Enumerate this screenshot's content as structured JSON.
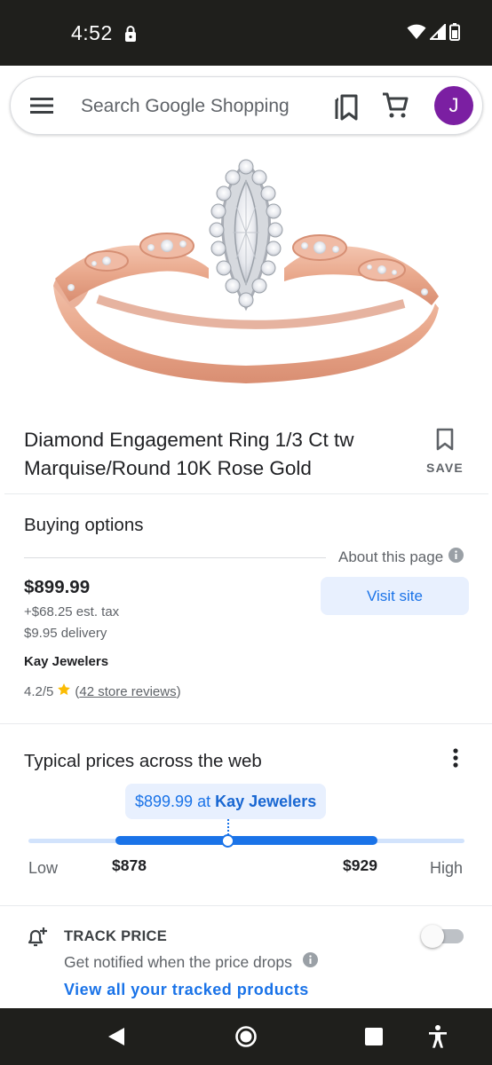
{
  "status_bar": {
    "time": "4:52"
  },
  "search": {
    "placeholder": "Search Google Shopping",
    "avatar_letter": "J"
  },
  "product": {
    "title": "Diamond Engagement Ring 1/3 Ct tw Marquise/Round 10K Rose Gold",
    "save_label": "SAVE"
  },
  "buying_options": {
    "heading": "Buying options",
    "about_label": "About this page",
    "price": "$899.99",
    "tax": "+$68.25 est. tax",
    "delivery": "$9.95 delivery",
    "store": "Kay Jewelers",
    "rating": "4.2/5",
    "reviews_link": "42 store reviews",
    "visit_label": "Visit site"
  },
  "typical_prices": {
    "heading": "Typical prices across the web",
    "current_price": "$899.99",
    "at_word": "at",
    "current_store": "Kay Jewelers",
    "low_label": "Low",
    "high_label": "High",
    "range_low": "$878",
    "range_high": "$929"
  },
  "track": {
    "title": "TRACK PRICE",
    "subtitle": "Get notified when the price drops",
    "link": "View all your tracked products",
    "enabled": false
  },
  "colors": {
    "accent": "#1a73e8",
    "avatar": "#7b1fa2",
    "bar_dark": "#1f1f1c",
    "star": "#fbbc04"
  }
}
